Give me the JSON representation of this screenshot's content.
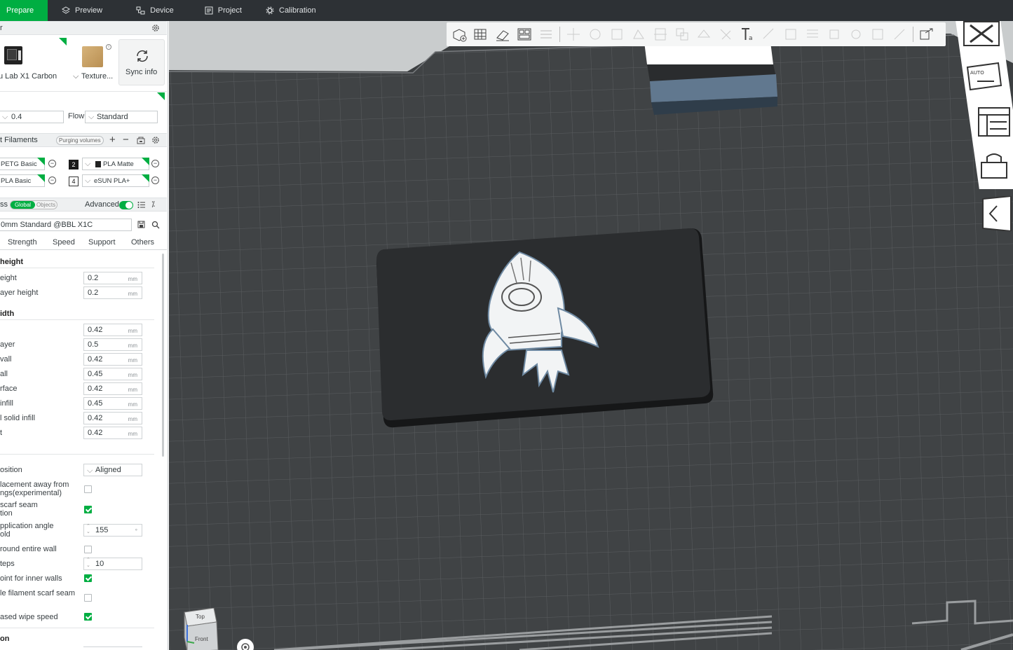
{
  "topbar": {
    "tabs": [
      {
        "label": "Prepare",
        "icon": "prepare-icon",
        "active": true
      },
      {
        "label": "Preview",
        "icon": "layers-icon",
        "active": false
      },
      {
        "label": "Device",
        "icon": "device-icon",
        "active": false
      },
      {
        "label": "Project",
        "icon": "project-icon",
        "active": false
      },
      {
        "label": "Calibration",
        "icon": "calibration-icon",
        "active": false
      }
    ]
  },
  "printer": {
    "section_title": "r",
    "printer_name": "u Lab X1 Carbon",
    "plate_name": "Texture...",
    "sync_label": "Sync info",
    "nozzle_value": "0.4",
    "flow_label": "Flow",
    "flow_value": "Standard"
  },
  "filaments": {
    "title": "t Filaments",
    "purging_label": "Purging volumes",
    "slots": [
      {
        "num": "",
        "name": "PETG Basic",
        "color": "#ffffff"
      },
      {
        "num": "2",
        "name": "PLA Matte",
        "color": "#1a1a1a"
      },
      {
        "num": "",
        "name": "PLA Basic",
        "color": "#ffffff"
      },
      {
        "num": "4",
        "name": "eSUN PLA+",
        "color": "#ffffff"
      }
    ]
  },
  "process": {
    "title": "ss",
    "toggle_global": "Global",
    "toggle_objects": "Objects",
    "advanced_label": "Advanced",
    "preset_value": "0mm Standard @BBL X1C",
    "tabs": [
      "Strength",
      "Speed",
      "Support",
      "Others"
    ]
  },
  "settings": {
    "layer_group": "height",
    "layer_rows": [
      {
        "label": "eight",
        "value": "0.2",
        "unit": "mm"
      },
      {
        "label": "ayer height",
        "value": "0.2",
        "unit": "mm"
      }
    ],
    "width_group": "idth",
    "width_rows": [
      {
        "label": "",
        "value": "0.42",
        "unit": "mm"
      },
      {
        "label": "ayer",
        "value": "0.5",
        "unit": "mm"
      },
      {
        "label": "vall",
        "value": "0.42",
        "unit": "mm"
      },
      {
        "label": "all",
        "value": "0.45",
        "unit": "mm"
      },
      {
        "label": "rface",
        "value": "0.42",
        "unit": "mm"
      },
      {
        "label": " infill",
        "value": "0.45",
        "unit": "mm"
      },
      {
        "label": "l solid infill",
        "value": "0.42",
        "unit": "mm"
      },
      {
        "label": "t",
        "value": "0.42",
        "unit": "mm"
      }
    ],
    "seam_position_label": "osition",
    "seam_position_value": "Aligned",
    "seam_rows": [
      {
        "label1": "lacement away from",
        "label2": "ngs(experimental)",
        "checked": false
      },
      {
        "label1": "scarf seam",
        "label2": "tion",
        "checked": true
      }
    ],
    "scarf_angle_label1": "pplication angle",
    "scarf_angle_label2": "old",
    "scarf_angle_value": "155",
    "scarf_angle_unit": "°",
    "entire_wall_label": "round entire wall",
    "steps_label": "teps",
    "steps_value": "10",
    "inner_walls_label": "oint for inner walls",
    "filament_scarf_label": "le filament scarf seam",
    "wipe_speed_label": "ased wipe speed",
    "bottom_group": "on"
  },
  "viewport": {
    "cube_top": "Top",
    "cube_front": "Front",
    "dock_auto_label": "AUTO"
  },
  "colors": {
    "accent": "#00ae42",
    "topbar": "#2d3135",
    "bed": "#3f4244",
    "plate": "#2b2d2f"
  }
}
